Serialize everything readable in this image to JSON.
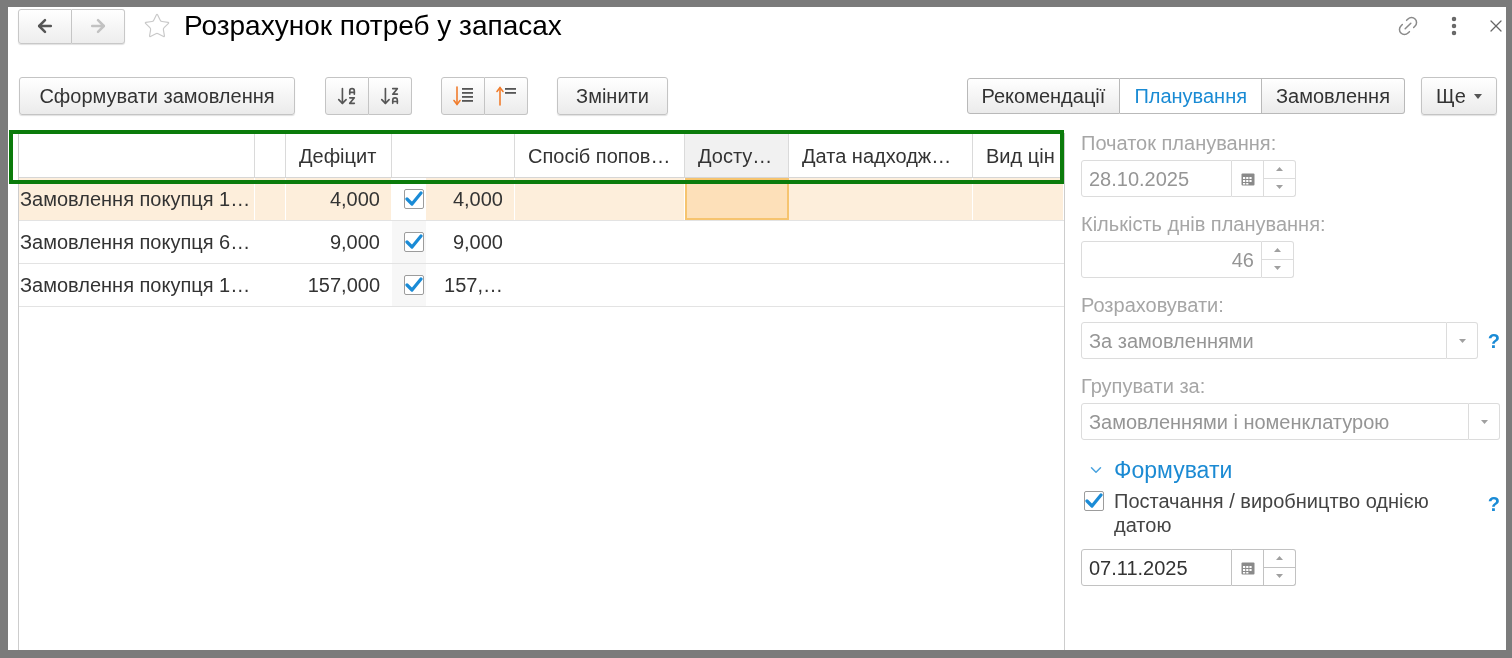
{
  "window": {
    "title": "Розрахунок потреб у запасах",
    "favorite": false
  },
  "nav": [
    {
      "kind": "back",
      "disabled": false
    },
    {
      "kind": "forward",
      "disabled": true
    }
  ],
  "toolbar": {
    "create_order": "Сформувати замовлення",
    "edit": "Змінити",
    "tabs": [
      {
        "label": "Рекомендації",
        "selected": false
      },
      {
        "label": "Планування",
        "selected": true
      },
      {
        "label": "Замовлення",
        "selected": false
      }
    ],
    "more": "Ще"
  },
  "table": {
    "header_highlighted": true,
    "columns": [
      {
        "selected": false
      },
      {
        "selected": false
      },
      {
        "label": "Дефіцит",
        "selected": false
      },
      {
        "selected": false
      },
      {
        "label": "Спосіб попов…",
        "selected": false
      },
      {
        "label": "Досту…",
        "selected": true
      },
      {
        "label": "Дата надходж…",
        "selected": false
      },
      {
        "label": "Вид цін",
        "selected": false
      }
    ],
    "rows": [
      {
        "selected": true,
        "column_1": "Замовлення покупця 1…",
        "deficit": "4,000",
        "checked": true,
        "column_4": "4,000"
      },
      {
        "selected": false,
        "column_1": "Замовлення покупця 6…",
        "deficit": "9,000",
        "checked": true,
        "column_4": "9,000"
      },
      {
        "selected": false,
        "column_1": "Замовлення покупця 1…",
        "deficit": "157,000",
        "checked": true,
        "column_4": "157,…"
      }
    ]
  },
  "settings": [
    {
      "kind": "date",
      "label": "Початок планування:",
      "value": "28.10.2025",
      "disabled": true
    },
    {
      "kind": "number",
      "label": "Кількість днів планування:",
      "value": "46",
      "disabled": true
    },
    {
      "kind": "select",
      "label": "Розраховувати:",
      "value": "За замовленнями",
      "disabled": true,
      "help": "?"
    },
    {
      "kind": "select",
      "label": "Групувати за:",
      "value": "Замовленнями і номенклатурою",
      "disabled": true
    },
    {
      "kind": "group",
      "title": "Формувати",
      "expanded": true,
      "children": [
        {
          "kind": "checkbox",
          "label": "Постачання / виробництво однією датою",
          "checked": true,
          "help": "?"
        },
        {
          "kind": "date",
          "value": "07.11.2025",
          "disabled": false
        }
      ]
    }
  ]
}
